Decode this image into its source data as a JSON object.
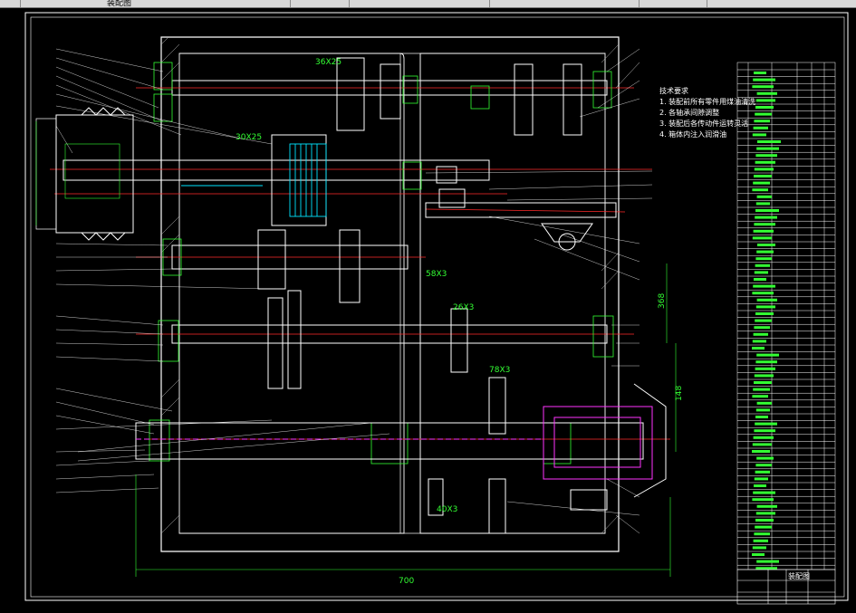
{
  "window": {
    "title": "装配图",
    "bg": "#000000",
    "toolbar_bg": "#d8d8d8"
  },
  "colors": {
    "outline": "#ffffff",
    "dimension": "#33ff33",
    "center_line": "#ff2a2a",
    "section": "#00e5ff",
    "spindle": "#ff33ff",
    "hatch": "#ffffff"
  },
  "gear_labels": {
    "g1": "36X25",
    "g2": "30X25",
    "g3": "58X3",
    "g4": "26X3",
    "g5": "78X3",
    "g6": "40X3"
  },
  "dimensions": {
    "overall_width": "700",
    "height_a": "368",
    "height_b": "148"
  },
  "notes_title": "技术要求",
  "notes": [
    "1. 装配前所有零件用煤油清洗",
    "2. 各轴承间隙调整",
    "3. 装配后各传动件运转灵活",
    "4. 箱体内注入润滑油"
  ],
  "title_block": {
    "drawing_title": "装配图"
  }
}
